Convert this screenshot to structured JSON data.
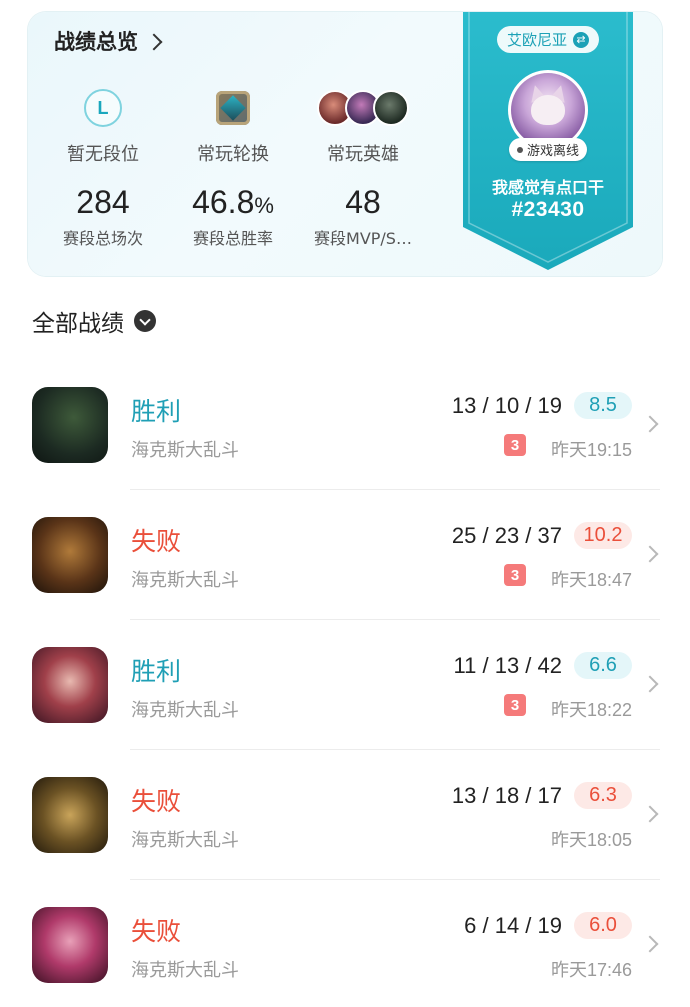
{
  "summary": {
    "title": "战绩总览",
    "rank": {
      "icon_letter": "L",
      "label": "暂无段位"
    },
    "rotation": {
      "label": "常玩轮换"
    },
    "heroes": {
      "label": "常玩英雄"
    },
    "games": {
      "value": "284",
      "label": "赛段总场次"
    },
    "winrate": {
      "value": "46.8",
      "unit": "%",
      "label": "赛段总胜率"
    },
    "mvp": {
      "value": "48",
      "label": "赛段MVP/S…"
    }
  },
  "profile": {
    "region": "艾欧尼亚",
    "status": "游戏离线",
    "name": "我感觉有点口干",
    "tag": "#23430",
    "accent_color": "#22b3c4"
  },
  "list_header": {
    "label": "全部战绩"
  },
  "matches": [
    {
      "result": "胜利",
      "outcome": "win",
      "mode": "海克斯大乱斗",
      "kda": "13 / 10 / 19",
      "score": "8.5",
      "badge": "3",
      "time": "昨天19:15"
    },
    {
      "result": "失败",
      "outcome": "loss",
      "mode": "海克斯大乱斗",
      "kda": "25 / 23 / 37",
      "score": "10.2",
      "badge": "3",
      "time": "昨天18:47"
    },
    {
      "result": "胜利",
      "outcome": "win",
      "mode": "海克斯大乱斗",
      "kda": "11 / 13 / 42",
      "score": "6.6",
      "badge": "3",
      "time": "昨天18:22"
    },
    {
      "result": "失败",
      "outcome": "loss",
      "mode": "海克斯大乱斗",
      "kda": "13 / 18 / 17",
      "score": "6.3",
      "badge": "",
      "time": "昨天18:05"
    },
    {
      "result": "失败",
      "outcome": "loss",
      "mode": "海克斯大乱斗",
      "kda": "6 / 14 / 19",
      "score": "6.0",
      "badge": "",
      "time": "昨天17:46"
    }
  ],
  "colors": {
    "win": "#1f9fb5",
    "loss": "#ea4f3a"
  }
}
